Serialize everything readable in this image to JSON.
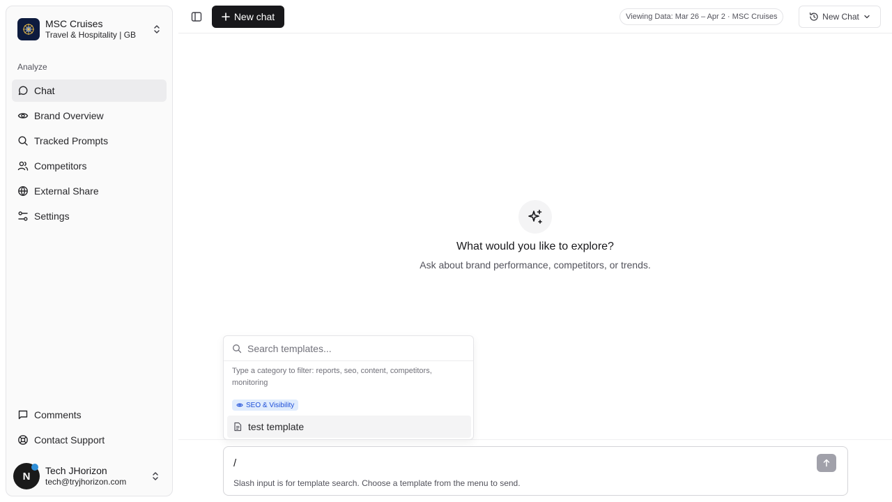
{
  "org": {
    "name": "MSC Cruises",
    "subtitle": "Travel & Hospitality | GB"
  },
  "sidebar": {
    "section_label": "Analyze",
    "items": [
      {
        "label": "Chat",
        "icon": "message-circle-icon",
        "active": true
      },
      {
        "label": "Brand Overview",
        "icon": "eye-icon"
      },
      {
        "label": "Tracked Prompts",
        "icon": "search-icon"
      },
      {
        "label": "Competitors",
        "icon": "users-icon"
      },
      {
        "label": "External Share",
        "icon": "globe-icon"
      },
      {
        "label": "Settings",
        "icon": "sliders-icon"
      }
    ],
    "bottom_items": [
      {
        "label": "Comments",
        "icon": "message-square-icon"
      },
      {
        "label": "Contact Support",
        "icon": "life-buoy-icon"
      }
    ]
  },
  "user": {
    "initial": "N",
    "name": "Tech JHorizon",
    "email": "tech@tryjhorizon.com"
  },
  "topbar": {
    "new_chat_label": "New chat",
    "viewing_data": "Viewing Data: Mar 26 – Apr 2 · MSC Cruises",
    "history_label": "New Chat"
  },
  "empty_state": {
    "title": "What would you like to explore?",
    "subtitle": "Ask about brand performance, competitors, or trends."
  },
  "template_menu": {
    "search_placeholder": "Search templates...",
    "hint": "Type a category to filter: reports, seo, content, competitors, monitoring",
    "category": "SEO & Visibility",
    "items": [
      {
        "label": "test template"
      }
    ]
  },
  "composer": {
    "value": "/",
    "hint": "Slash input is for template search. Choose a template from the menu to send."
  },
  "colors": {
    "primary": "#18181b",
    "category_bg": "#e0ecfd",
    "category_text": "#1d4ed8"
  }
}
